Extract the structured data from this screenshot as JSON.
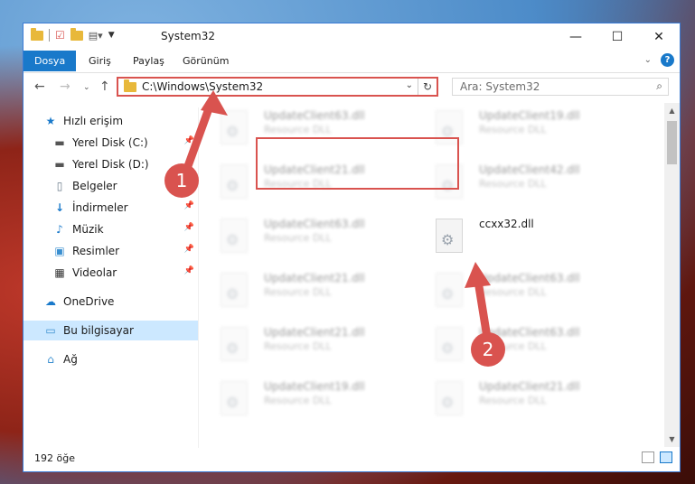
{
  "window": {
    "title": "System32",
    "controls": {
      "minimize": "—",
      "maximize": "☐",
      "close": "✕"
    }
  },
  "ribbon": {
    "tabs": [
      {
        "label": "Dosya",
        "active": true
      },
      {
        "label": "Giriş",
        "active": false
      },
      {
        "label": "Paylaş",
        "active": false
      },
      {
        "label": "Görünüm",
        "active": false
      }
    ]
  },
  "navbar": {
    "address": "C:\\Windows\\System32",
    "search_placeholder": "Ara: System32"
  },
  "sidebar": {
    "items": [
      {
        "label": "Hızlı erişim",
        "icon": "star-icon",
        "pinned": false
      },
      {
        "label": "Yerel Disk (C:)",
        "icon": "drive-icon",
        "pinned": true
      },
      {
        "label": "Yerel Disk (D:)",
        "icon": "drive-icon",
        "pinned": true
      },
      {
        "label": "Belgeler",
        "icon": "document-icon",
        "pinned": true
      },
      {
        "label": "İndirmeler",
        "icon": "download-icon",
        "pinned": true
      },
      {
        "label": "Müzik",
        "icon": "music-icon",
        "pinned": true
      },
      {
        "label": "Resimler",
        "icon": "pictures-icon",
        "pinned": true
      },
      {
        "label": "Videolar",
        "icon": "video-icon",
        "pinned": true
      },
      {
        "label": "OneDrive",
        "icon": "cloud-icon",
        "pinned": false
      },
      {
        "label": "Bu bilgisayar",
        "icon": "computer-icon",
        "pinned": false,
        "selected": true
      },
      {
        "label": "Ağ",
        "icon": "network-icon",
        "pinned": false
      }
    ]
  },
  "files": [
    {
      "name": "UpdateClient63.dll",
      "type": "Resource DLL",
      "blurred": true
    },
    {
      "name": "UpdateClient19.dll",
      "type": "Resource DLL",
      "blurred": true
    },
    {
      "name": "UpdateClient21.dll",
      "type": "Resource DLL",
      "blurred": true
    },
    {
      "name": "UpdateClient42.dll",
      "type": "Resource DLL",
      "blurred": true
    },
    {
      "name": "UpdateClient63.dll",
      "type": "Resource DLL",
      "blurred": true
    },
    {
      "name": "ccxx32.dll",
      "type": "",
      "blurred": false
    },
    {
      "name": "UpdateClient21.dll",
      "type": "Resource DLL",
      "blurred": true
    },
    {
      "name": "UpdateClient63.dll",
      "type": "Resource DLL",
      "blurred": true
    },
    {
      "name": "UpdateClient21.dll",
      "type": "Resource DLL",
      "blurred": true
    },
    {
      "name": "UpdateClient63.dll",
      "type": "Resource DLL",
      "blurred": true
    },
    {
      "name": "UpdateClient19.dll",
      "type": "Resource DLL",
      "blurred": true
    },
    {
      "name": "UpdateClient21.dll",
      "type": "Resource DLL",
      "blurred": true
    }
  ],
  "status": {
    "count": "192 öğe"
  },
  "annotations": {
    "step1": "1",
    "step2": "2",
    "color": "#d9534f"
  }
}
